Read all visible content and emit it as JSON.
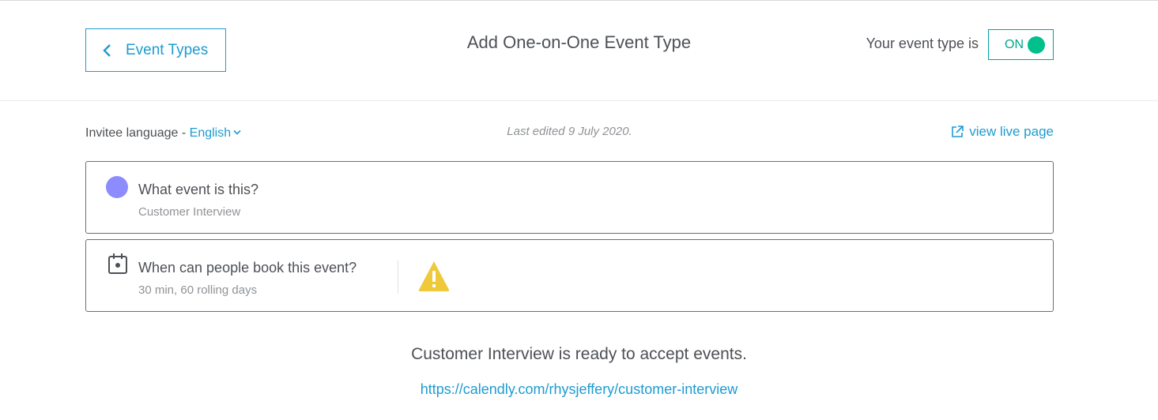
{
  "header": {
    "back_label": "Event Types",
    "title": "Add One-on-One Event Type",
    "status_label": "Your event type is",
    "toggle_label": "ON"
  },
  "subbar": {
    "language_prefix": "Invitee language - ",
    "language_value": "English",
    "last_edited": "Last edited 9 July 2020.",
    "view_live_label": "view live page"
  },
  "cards": [
    {
      "title": "What event is this?",
      "subtitle": "Customer Interview",
      "icon": "purple-dot-icon"
    },
    {
      "title": "When can people book this event?",
      "subtitle": "30 min, 60 rolling days",
      "icon": "calendar-icon",
      "warning_icon": "warning-icon"
    }
  ],
  "footer": {
    "ready_text": "Customer Interview is ready to accept events.",
    "link_text": "https://calendly.com/rhysjeffery/customer-interview"
  },
  "colors": {
    "accent": "#1d9bd1",
    "toggle_on": "#00c08b",
    "event_dot": "#8c8cff",
    "warning": "#f0c93a"
  }
}
